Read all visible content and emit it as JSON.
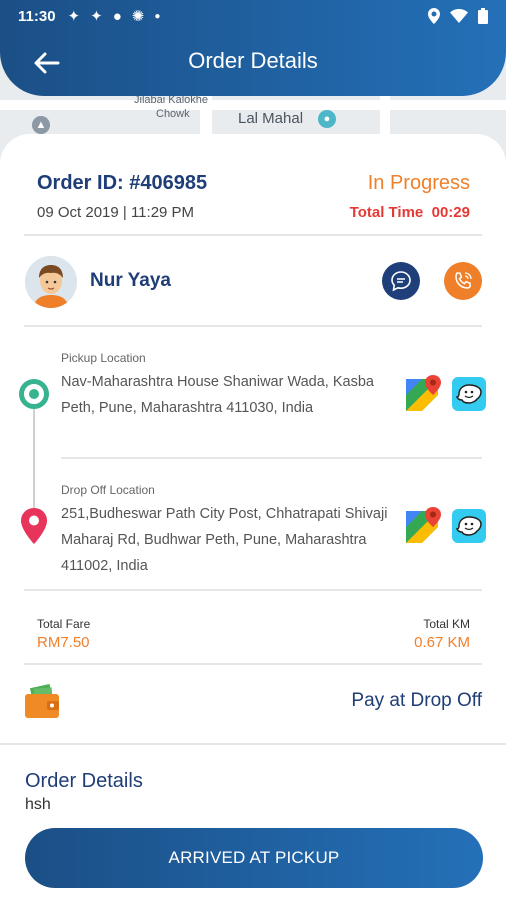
{
  "status_bar": {
    "time": "11:30"
  },
  "map": {
    "labels": [
      "Jilabai Kalokhe",
      "Chowk",
      "Lal Mahal"
    ]
  },
  "header": {
    "title": "Order Details"
  },
  "order": {
    "id": "Order ID: #406985",
    "date": "09 Oct 2019 | 11:29 PM",
    "status": "In Progress",
    "total_time_label": "Total Time",
    "total_time_value": "00:29"
  },
  "customer": {
    "name": "Nur Yaya"
  },
  "pickup": {
    "label": "Pickup Location",
    "address": "Nav-Maharashtra House Shaniwar Wada, Kasba Peth, Pune, Maharashtra 411030, India"
  },
  "dropoff": {
    "label": "Drop Off Location",
    "address": "251,Budheswar Path City Post, Chhatrapati Shivaji Maharaj Rd, Budhwar Peth, Pune, Maharashtra 411002, India"
  },
  "fare": {
    "label": "Total Fare",
    "value": "RM7.50"
  },
  "distance": {
    "label": "Total KM",
    "value": "0.67 KM"
  },
  "payment": {
    "method": "Pay at Drop Off"
  },
  "order_details": {
    "title": "Order Details",
    "note": "hsh"
  },
  "action": {
    "label": "ARRIVED AT PICKUP"
  },
  "colors": {
    "primary": "#1f3d77",
    "accent": "#f07f2a",
    "alert": "#e53935",
    "pickup": "#37b38f",
    "dropoff": "#e8335a"
  },
  "icons": [
    "back-arrow-icon",
    "chat-icon",
    "phone-icon",
    "google-maps-icon",
    "waze-icon",
    "wallet-icon",
    "location-pin-icon"
  ]
}
